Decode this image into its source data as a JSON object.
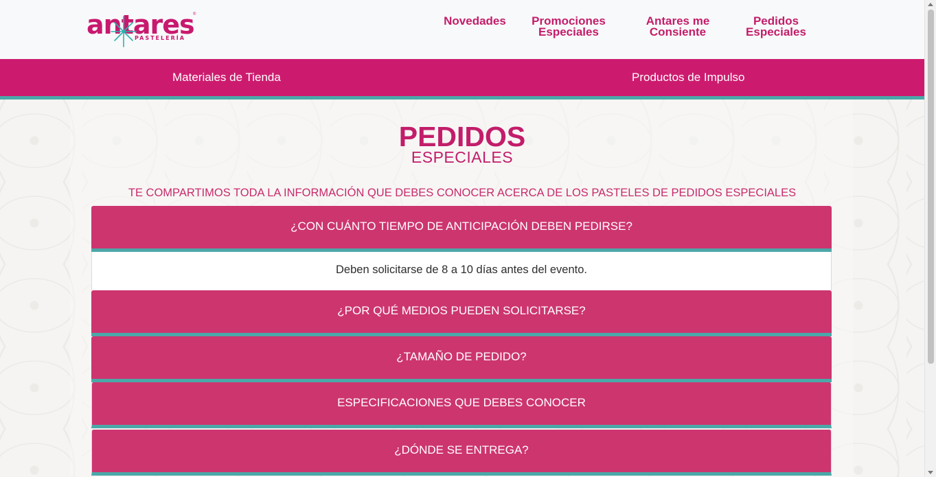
{
  "brand": {
    "logo_text": "antares",
    "logo_sub": "PASTELERÍA",
    "colors": {
      "primary": "#cc1b6e",
      "accent": "#4ba8a8",
      "accordion": "#cd356f"
    }
  },
  "header": {
    "nav": [
      {
        "label": "Novedades"
      },
      {
        "label": "Promociones Especiales"
      },
      {
        "label": "Antares me Consiente"
      },
      {
        "label": "Pedidos Especiales"
      }
    ]
  },
  "subnav": {
    "items": [
      {
        "label": "Materiales de Tienda"
      },
      {
        "label": "Productos de Impulso"
      }
    ]
  },
  "main": {
    "title_line1": "PEDIDOS",
    "title_line2": "ESPECIALES",
    "intro": "TE COMPARTIMOS TODA LA INFORMACIÓN QUE DEBES CONOCER ACERCA DE LOS PASTELES DE PEDIDOS ESPECIALES",
    "faq": [
      {
        "question": "¿CON CUÁNTO TIEMPO DE ANTICIPACIÓN DEBEN PEDIRSE?",
        "answer": "Deben solicitarse de 8 a 10 días antes del evento.",
        "expanded": true
      },
      {
        "question": "¿POR QUÉ MEDIOS PUEDEN SOLICITARSE?",
        "expanded": false
      },
      {
        "question": "¿TAMAÑO DE PEDIDO?",
        "expanded": false
      },
      {
        "question": "ESPECIFICACIONES QUE DEBES CONOCER",
        "expanded": false
      },
      {
        "question": "¿DÓNDE SE ENTREGA?",
        "expanded": false
      }
    ]
  }
}
